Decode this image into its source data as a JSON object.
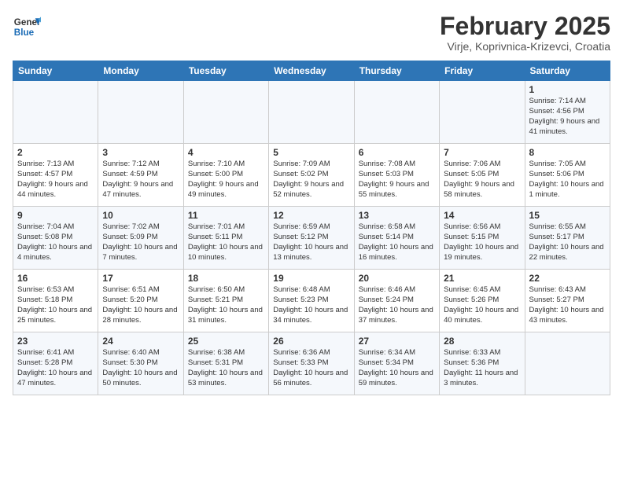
{
  "header": {
    "logo_general": "General",
    "logo_blue": "Blue",
    "title": "February 2025",
    "subtitle": "Virje, Koprivnica-Krizevci, Croatia"
  },
  "days_of_week": [
    "Sunday",
    "Monday",
    "Tuesday",
    "Wednesday",
    "Thursday",
    "Friday",
    "Saturday"
  ],
  "weeks": [
    {
      "days": [
        {
          "num": "",
          "info": ""
        },
        {
          "num": "",
          "info": ""
        },
        {
          "num": "",
          "info": ""
        },
        {
          "num": "",
          "info": ""
        },
        {
          "num": "",
          "info": ""
        },
        {
          "num": "",
          "info": ""
        },
        {
          "num": "1",
          "info": "Sunrise: 7:14 AM\nSunset: 4:56 PM\nDaylight: 9 hours and 41 minutes."
        }
      ]
    },
    {
      "days": [
        {
          "num": "2",
          "info": "Sunrise: 7:13 AM\nSunset: 4:57 PM\nDaylight: 9 hours and 44 minutes."
        },
        {
          "num": "3",
          "info": "Sunrise: 7:12 AM\nSunset: 4:59 PM\nDaylight: 9 hours and 47 minutes."
        },
        {
          "num": "4",
          "info": "Sunrise: 7:10 AM\nSunset: 5:00 PM\nDaylight: 9 hours and 49 minutes."
        },
        {
          "num": "5",
          "info": "Sunrise: 7:09 AM\nSunset: 5:02 PM\nDaylight: 9 hours and 52 minutes."
        },
        {
          "num": "6",
          "info": "Sunrise: 7:08 AM\nSunset: 5:03 PM\nDaylight: 9 hours and 55 minutes."
        },
        {
          "num": "7",
          "info": "Sunrise: 7:06 AM\nSunset: 5:05 PM\nDaylight: 9 hours and 58 minutes."
        },
        {
          "num": "8",
          "info": "Sunrise: 7:05 AM\nSunset: 5:06 PM\nDaylight: 10 hours and 1 minute."
        }
      ]
    },
    {
      "days": [
        {
          "num": "9",
          "info": "Sunrise: 7:04 AM\nSunset: 5:08 PM\nDaylight: 10 hours and 4 minutes."
        },
        {
          "num": "10",
          "info": "Sunrise: 7:02 AM\nSunset: 5:09 PM\nDaylight: 10 hours and 7 minutes."
        },
        {
          "num": "11",
          "info": "Sunrise: 7:01 AM\nSunset: 5:11 PM\nDaylight: 10 hours and 10 minutes."
        },
        {
          "num": "12",
          "info": "Sunrise: 6:59 AM\nSunset: 5:12 PM\nDaylight: 10 hours and 13 minutes."
        },
        {
          "num": "13",
          "info": "Sunrise: 6:58 AM\nSunset: 5:14 PM\nDaylight: 10 hours and 16 minutes."
        },
        {
          "num": "14",
          "info": "Sunrise: 6:56 AM\nSunset: 5:15 PM\nDaylight: 10 hours and 19 minutes."
        },
        {
          "num": "15",
          "info": "Sunrise: 6:55 AM\nSunset: 5:17 PM\nDaylight: 10 hours and 22 minutes."
        }
      ]
    },
    {
      "days": [
        {
          "num": "16",
          "info": "Sunrise: 6:53 AM\nSunset: 5:18 PM\nDaylight: 10 hours and 25 minutes."
        },
        {
          "num": "17",
          "info": "Sunrise: 6:51 AM\nSunset: 5:20 PM\nDaylight: 10 hours and 28 minutes."
        },
        {
          "num": "18",
          "info": "Sunrise: 6:50 AM\nSunset: 5:21 PM\nDaylight: 10 hours and 31 minutes."
        },
        {
          "num": "19",
          "info": "Sunrise: 6:48 AM\nSunset: 5:23 PM\nDaylight: 10 hours and 34 minutes."
        },
        {
          "num": "20",
          "info": "Sunrise: 6:46 AM\nSunset: 5:24 PM\nDaylight: 10 hours and 37 minutes."
        },
        {
          "num": "21",
          "info": "Sunrise: 6:45 AM\nSunset: 5:26 PM\nDaylight: 10 hours and 40 minutes."
        },
        {
          "num": "22",
          "info": "Sunrise: 6:43 AM\nSunset: 5:27 PM\nDaylight: 10 hours and 43 minutes."
        }
      ]
    },
    {
      "days": [
        {
          "num": "23",
          "info": "Sunrise: 6:41 AM\nSunset: 5:28 PM\nDaylight: 10 hours and 47 minutes."
        },
        {
          "num": "24",
          "info": "Sunrise: 6:40 AM\nSunset: 5:30 PM\nDaylight: 10 hours and 50 minutes."
        },
        {
          "num": "25",
          "info": "Sunrise: 6:38 AM\nSunset: 5:31 PM\nDaylight: 10 hours and 53 minutes."
        },
        {
          "num": "26",
          "info": "Sunrise: 6:36 AM\nSunset: 5:33 PM\nDaylight: 10 hours and 56 minutes."
        },
        {
          "num": "27",
          "info": "Sunrise: 6:34 AM\nSunset: 5:34 PM\nDaylight: 10 hours and 59 minutes."
        },
        {
          "num": "28",
          "info": "Sunrise: 6:33 AM\nSunset: 5:36 PM\nDaylight: 11 hours and 3 minutes."
        },
        {
          "num": "",
          "info": ""
        }
      ]
    }
  ]
}
